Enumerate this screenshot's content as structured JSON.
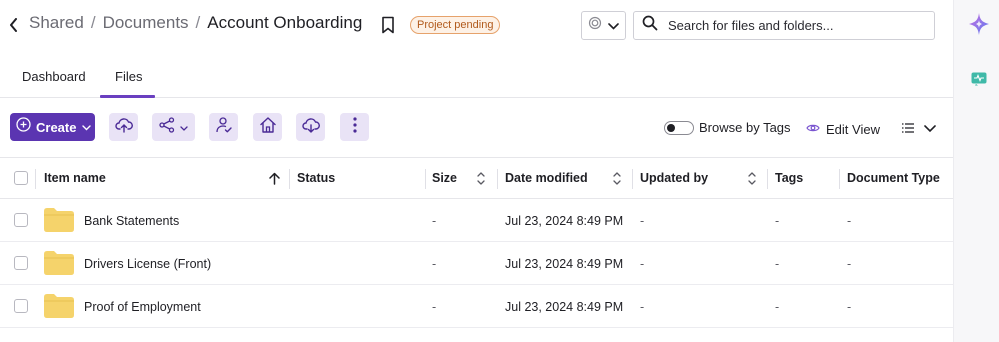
{
  "breadcrumb": {
    "items": [
      "Shared",
      "Documents"
    ],
    "separator": "/",
    "current": "Account Onboarding"
  },
  "status_badge": "Project pending",
  "search": {
    "placeholder": "Search for files and folders..."
  },
  "tabs": [
    {
      "label": "Dashboard",
      "active": false
    },
    {
      "label": "Files",
      "active": true
    }
  ],
  "toolbar": {
    "create_label": "Create",
    "browse_by_tags_label": "Browse by Tags",
    "browse_by_tags_on": false,
    "edit_view_label": "Edit View",
    "icons": [
      "cloud-upload-icon",
      "share-icon",
      "user-check-icon",
      "home-icon",
      "cloud-download-icon",
      "more-vertical-icon"
    ]
  },
  "table": {
    "columns": [
      "Item name",
      "Status",
      "Size",
      "Date modified",
      "Updated by",
      "Tags",
      "Document Type"
    ],
    "rows": [
      {
        "name": "Bank Statements",
        "status": "",
        "size": "-",
        "date_modified": "Jul 23, 2024 8:49 PM",
        "updated_by": "-",
        "tags": "-",
        "document_type": "-"
      },
      {
        "name": "Drivers License (Front)",
        "status": "",
        "size": "-",
        "date_modified": "Jul 23, 2024 8:49 PM",
        "updated_by": "-",
        "tags": "-",
        "document_type": "-"
      },
      {
        "name": "Proof of Employment",
        "status": "",
        "size": "-",
        "date_modified": "Jul 23, 2024 8:49 PM",
        "updated_by": "-",
        "tags": "-",
        "document_type": "-"
      }
    ]
  },
  "colors": {
    "accent": "#5b35b1",
    "accent_light": "#e9e3f6",
    "badge_border": "#e6a26b",
    "badge_text": "#b15a1c",
    "folder": "#f5d36b"
  }
}
